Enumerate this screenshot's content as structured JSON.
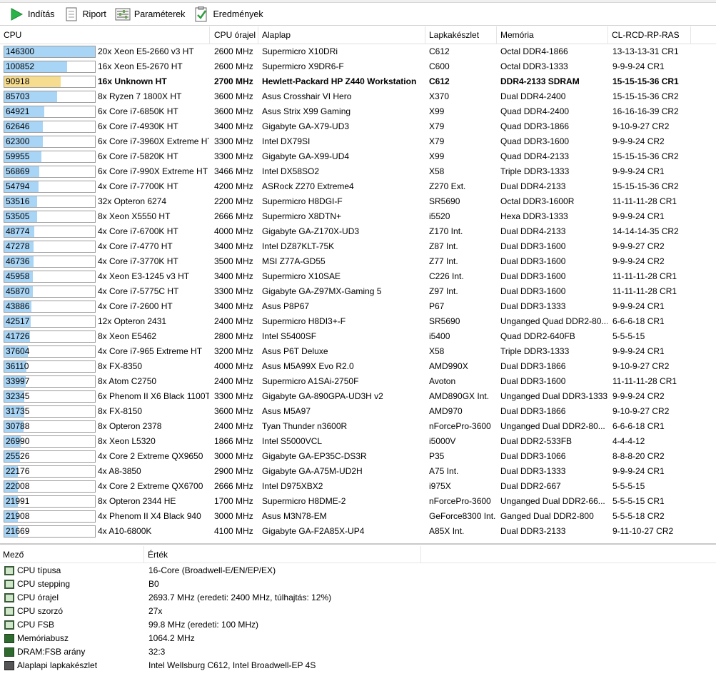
{
  "toolbar": {
    "start": "Indítás",
    "report": "Riport",
    "params": "Paraméterek",
    "results": "Eredmények"
  },
  "columns": {
    "cpu": "CPU",
    "clock": "CPU órajel",
    "board": "Alaplap",
    "chipset": "Lapkakészlet",
    "memory": "Memória",
    "timing": "CL-RCD-RP-RAS"
  },
  "max_score": 146300,
  "rows": [
    {
      "score": "146300",
      "cpu": "20x Xeon E5-2660 v3 HT",
      "clock": "2600 MHz",
      "board": "Supermicro X10DRi",
      "chipset": "C612",
      "memory": "Octal DDR4-1866",
      "timing": "13-13-13-31 CR1"
    },
    {
      "score": "100852",
      "cpu": "16x Xeon E5-2670 HT",
      "clock": "2600 MHz",
      "board": "Supermicro X9DR6-F",
      "chipset": "C600",
      "memory": "Octal DDR3-1333",
      "timing": "9-9-9-24 CR1"
    },
    {
      "score": "90918",
      "cpu": "16x Unknown HT",
      "clock": "2700 MHz",
      "board": "Hewlett-Packard HP Z440 Workstation",
      "chipset": "C612",
      "memory": "DDR4-2133 SDRAM",
      "timing": "15-15-15-36 CR1",
      "highlight": true
    },
    {
      "score": "85703",
      "cpu": "8x Ryzen 7 1800X HT",
      "clock": "3600 MHz",
      "board": "Asus Crosshair VI Hero",
      "chipset": "X370",
      "memory": "Dual DDR4-2400",
      "timing": "15-15-15-36 CR2"
    },
    {
      "score": "64921",
      "cpu": "6x Core i7-6850K HT",
      "clock": "3600 MHz",
      "board": "Asus Strix X99 Gaming",
      "chipset": "X99",
      "memory": "Quad DDR4-2400",
      "timing": "16-16-16-39 CR2"
    },
    {
      "score": "62646",
      "cpu": "6x Core i7-4930K HT",
      "clock": "3400 MHz",
      "board": "Gigabyte GA-X79-UD3",
      "chipset": "X79",
      "memory": "Quad DDR3-1866",
      "timing": "9-10-9-27 CR2"
    },
    {
      "score": "62300",
      "cpu": "6x Core i7-3960X Extreme HT",
      "clock": "3300 MHz",
      "board": "Intel DX79SI",
      "chipset": "X79",
      "memory": "Quad DDR3-1600",
      "timing": "9-9-9-24 CR2"
    },
    {
      "score": "59955",
      "cpu": "6x Core i7-5820K HT",
      "clock": "3300 MHz",
      "board": "Gigabyte GA-X99-UD4",
      "chipset": "X99",
      "memory": "Quad DDR4-2133",
      "timing": "15-15-15-36 CR2"
    },
    {
      "score": "56869",
      "cpu": "6x Core i7-990X Extreme HT",
      "clock": "3466 MHz",
      "board": "Intel DX58SO2",
      "chipset": "X58",
      "memory": "Triple DDR3-1333",
      "timing": "9-9-9-24 CR1"
    },
    {
      "score": "54794",
      "cpu": "4x Core i7-7700K HT",
      "clock": "4200 MHz",
      "board": "ASRock Z270 Extreme4",
      "chipset": "Z270 Ext.",
      "memory": "Dual DDR4-2133",
      "timing": "15-15-15-36 CR2"
    },
    {
      "score": "53516",
      "cpu": "32x Opteron 6274",
      "clock": "2200 MHz",
      "board": "Supermicro H8DGI-F",
      "chipset": "SR5690",
      "memory": "Octal DDR3-1600R",
      "timing": "11-11-11-28 CR1"
    },
    {
      "score": "53505",
      "cpu": "8x Xeon X5550 HT",
      "clock": "2666 MHz",
      "board": "Supermicro X8DTN+",
      "chipset": "i5520",
      "memory": "Hexa DDR3-1333",
      "timing": "9-9-9-24 CR1"
    },
    {
      "score": "48774",
      "cpu": "4x Core i7-6700K HT",
      "clock": "4000 MHz",
      "board": "Gigabyte GA-Z170X-UD3",
      "chipset": "Z170 Int.",
      "memory": "Dual DDR4-2133",
      "timing": "14-14-14-35 CR2"
    },
    {
      "score": "47278",
      "cpu": "4x Core i7-4770 HT",
      "clock": "3400 MHz",
      "board": "Intel DZ87KLT-75K",
      "chipset": "Z87 Int.",
      "memory": "Dual DDR3-1600",
      "timing": "9-9-9-27 CR2"
    },
    {
      "score": "46736",
      "cpu": "4x Core i7-3770K HT",
      "clock": "3500 MHz",
      "board": "MSI Z77A-GD55",
      "chipset": "Z77 Int.",
      "memory": "Dual DDR3-1600",
      "timing": "9-9-9-24 CR2"
    },
    {
      "score": "45958",
      "cpu": "4x Xeon E3-1245 v3 HT",
      "clock": "3400 MHz",
      "board": "Supermicro X10SAE",
      "chipset": "C226 Int.",
      "memory": "Dual DDR3-1600",
      "timing": "11-11-11-28 CR1"
    },
    {
      "score": "45870",
      "cpu": "4x Core i7-5775C HT",
      "clock": "3300 MHz",
      "board": "Gigabyte GA-Z97MX-Gaming 5",
      "chipset": "Z97 Int.",
      "memory": "Dual DDR3-1600",
      "timing": "11-11-11-28 CR1"
    },
    {
      "score": "43886",
      "cpu": "4x Core i7-2600 HT",
      "clock": "3400 MHz",
      "board": "Asus P8P67",
      "chipset": "P67",
      "memory": "Dual DDR3-1333",
      "timing": "9-9-9-24 CR1"
    },
    {
      "score": "42517",
      "cpu": "12x Opteron 2431",
      "clock": "2400 MHz",
      "board": "Supermicro H8DI3+-F",
      "chipset": "SR5690",
      "memory": "Unganged Quad DDR2-80...",
      "timing": "6-6-6-18 CR1"
    },
    {
      "score": "41726",
      "cpu": "8x Xeon E5462",
      "clock": "2800 MHz",
      "board": "Intel S5400SF",
      "chipset": "i5400",
      "memory": "Quad DDR2-640FB",
      "timing": "5-5-5-15"
    },
    {
      "score": "37604",
      "cpu": "4x Core i7-965 Extreme HT",
      "clock": "3200 MHz",
      "board": "Asus P6T Deluxe",
      "chipset": "X58",
      "memory": "Triple DDR3-1333",
      "timing": "9-9-9-24 CR1"
    },
    {
      "score": "36110",
      "cpu": "8x FX-8350",
      "clock": "4000 MHz",
      "board": "Asus M5A99X Evo R2.0",
      "chipset": "AMD990X",
      "memory": "Dual DDR3-1866",
      "timing": "9-10-9-27 CR2"
    },
    {
      "score": "33997",
      "cpu": "8x Atom C2750",
      "clock": "2400 MHz",
      "board": "Supermicro A1SAi-2750F",
      "chipset": "Avoton",
      "memory": "Dual DDR3-1600",
      "timing": "11-11-11-28 CR1"
    },
    {
      "score": "32345",
      "cpu": "6x Phenom II X6 Black 1100T",
      "clock": "3300 MHz",
      "board": "Gigabyte GA-890GPA-UD3H v2",
      "chipset": "AMD890GX Int.",
      "memory": "Unganged Dual DDR3-1333",
      "timing": "9-9-9-24 CR2"
    },
    {
      "score": "31735",
      "cpu": "8x FX-8150",
      "clock": "3600 MHz",
      "board": "Asus M5A97",
      "chipset": "AMD970",
      "memory": "Dual DDR3-1866",
      "timing": "9-10-9-27 CR2"
    },
    {
      "score": "30788",
      "cpu": "8x Opteron 2378",
      "clock": "2400 MHz",
      "board": "Tyan Thunder n3600R",
      "chipset": "nForcePro-3600",
      "memory": "Unganged Dual DDR2-80...",
      "timing": "6-6-6-18 CR1"
    },
    {
      "score": "26990",
      "cpu": "8x Xeon L5320",
      "clock": "1866 MHz",
      "board": "Intel S5000VCL",
      "chipset": "i5000V",
      "memory": "Dual DDR2-533FB",
      "timing": "4-4-4-12"
    },
    {
      "score": "25526",
      "cpu": "4x Core 2 Extreme QX9650",
      "clock": "3000 MHz",
      "board": "Gigabyte GA-EP35C-DS3R",
      "chipset": "P35",
      "memory": "Dual DDR3-1066",
      "timing": "8-8-8-20 CR2"
    },
    {
      "score": "22176",
      "cpu": "4x A8-3850",
      "clock": "2900 MHz",
      "board": "Gigabyte GA-A75M-UD2H",
      "chipset": "A75 Int.",
      "memory": "Dual DDR3-1333",
      "timing": "9-9-9-24 CR1"
    },
    {
      "score": "22008",
      "cpu": "4x Core 2 Extreme QX6700",
      "clock": "2666 MHz",
      "board": "Intel D975XBX2",
      "chipset": "i975X",
      "memory": "Dual DDR2-667",
      "timing": "5-5-5-15"
    },
    {
      "score": "21991",
      "cpu": "8x Opteron 2344 HE",
      "clock": "1700 MHz",
      "board": "Supermicro H8DME-2",
      "chipset": "nForcePro-3600",
      "memory": "Unganged Dual DDR2-66...",
      "timing": "5-5-5-15 CR1"
    },
    {
      "score": "21908",
      "cpu": "4x Phenom II X4 Black 940",
      "clock": "3000 MHz",
      "board": "Asus M3N78-EM",
      "chipset": "GeForce8300 Int.",
      "memory": "Ganged Dual DDR2-800",
      "timing": "5-5-5-18 CR2"
    },
    {
      "score": "21669",
      "cpu": "4x A10-6800K",
      "clock": "4100 MHz",
      "board": "Gigabyte GA-F2A85X-UP4",
      "chipset": "A85X Int.",
      "memory": "Dual DDR3-2133",
      "timing": "9-11-10-27 CR2"
    }
  ],
  "detail": {
    "col_field": "Mező",
    "col_value": "Érték",
    "items": [
      {
        "field": "CPU típusa",
        "value": "16-Core   (Broadwell-E/EN/EP/EX)",
        "icon": "chip-icon"
      },
      {
        "field": "CPU stepping",
        "value": "B0",
        "icon": "chip-icon"
      },
      {
        "field": "CPU órajel",
        "value": "2693.7 MHz  (eredeti: 2400 MHz, túlhajtás: 12%)",
        "icon": "chip-icon"
      },
      {
        "field": "CPU szorzó",
        "value": "27x",
        "icon": "chip-icon"
      },
      {
        "field": "CPU FSB",
        "value": "99.8 MHz  (eredeti: 100 MHz)",
        "icon": "chip-icon"
      },
      {
        "field": "Memóriabusz",
        "value": "1064.2 MHz",
        "icon": "ram-icon"
      },
      {
        "field": "DRAM:FSB arány",
        "value": "32:3",
        "icon": "ram-icon"
      },
      {
        "field": "Alaplapi lapkakészlet",
        "value": "Intel Wellsburg C612, Intel Broadwell-EP 4S",
        "icon": "motherboard-icon"
      }
    ]
  }
}
